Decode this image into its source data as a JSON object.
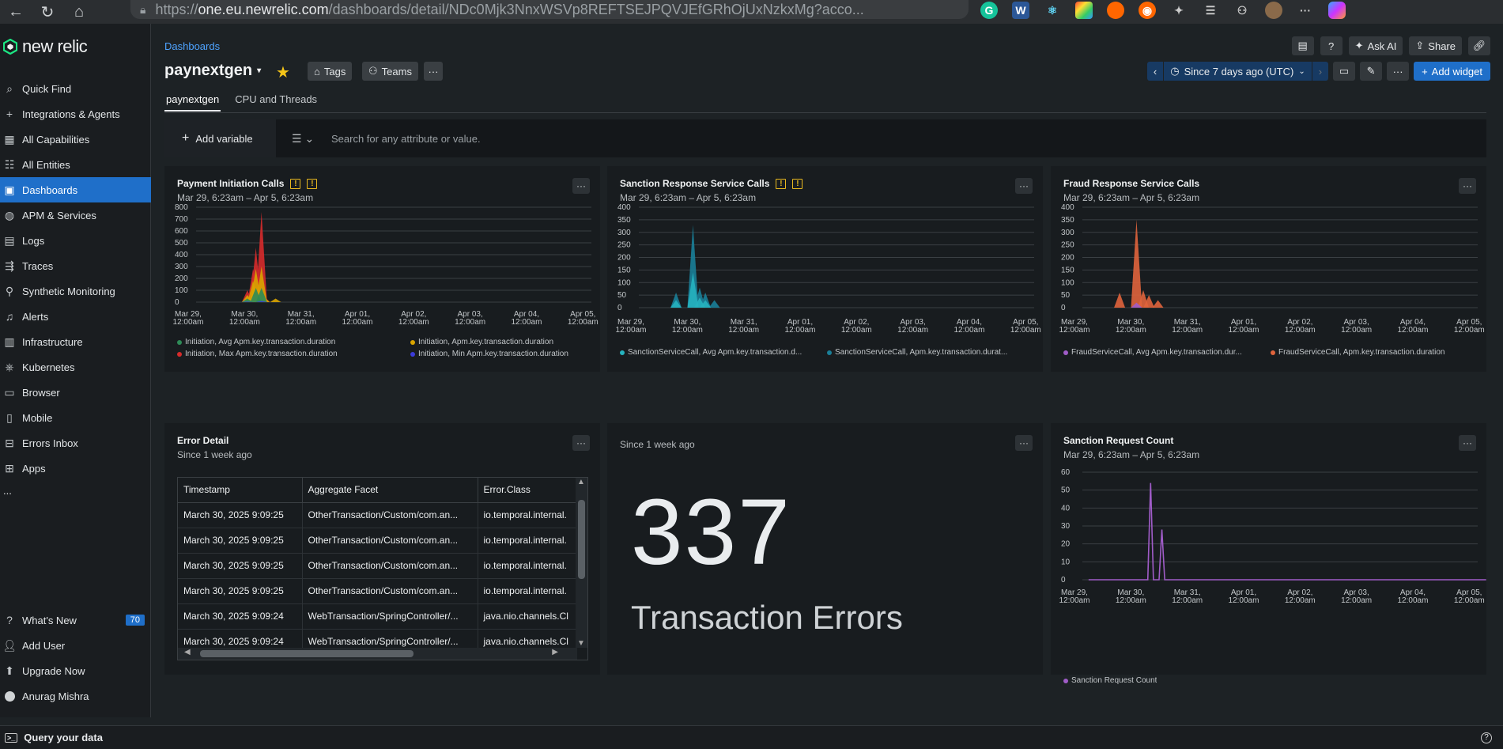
{
  "browser": {
    "url_prefix": "https://",
    "url_domain": "one.eu.newrelic.com",
    "url_path": "/dashboards/detail/NDc0Mjk3NnxWSVp8REFTSEJPQVJEfGRhOjUxNzkxMg?acco..."
  },
  "app": {
    "logo_text": "new relic"
  },
  "sidebar": {
    "items": [
      {
        "label": "Quick Find",
        "icon": "search-icon"
      },
      {
        "label": "Integrations & Agents",
        "icon": "plus-icon"
      },
      {
        "label": "All Capabilities",
        "icon": "grid-icon"
      },
      {
        "label": "All Entities",
        "icon": "list-icon"
      },
      {
        "label": "Dashboards",
        "icon": "dashboard-icon",
        "active": true
      },
      {
        "label": "APM & Services",
        "icon": "globe-icon"
      },
      {
        "label": "Logs",
        "icon": "doc-icon"
      },
      {
        "label": "Traces",
        "icon": "trace-icon"
      },
      {
        "label": "Synthetic Monitoring",
        "icon": "monitor-icon"
      },
      {
        "label": "Alerts",
        "icon": "bell-icon"
      },
      {
        "label": "Infrastructure",
        "icon": "server-icon"
      },
      {
        "label": "Kubernetes",
        "icon": "kubernetes-icon"
      },
      {
        "label": "Browser",
        "icon": "browser-icon"
      },
      {
        "label": "Mobile",
        "icon": "mobile-icon"
      },
      {
        "label": "Errors Inbox",
        "icon": "inbox-icon"
      },
      {
        "label": "Apps",
        "icon": "apps-icon"
      }
    ],
    "more": "...",
    "bottom": [
      {
        "label": "What's New",
        "badge": "70"
      },
      {
        "label": "Add User"
      },
      {
        "label": "Upgrade Now"
      },
      {
        "label": "Anurag Mishra"
      }
    ]
  },
  "query_bar": {
    "label": "Query your data"
  },
  "header": {
    "breadcrumb": "Dashboards",
    "title": "paynextgen",
    "tags_label": "Tags",
    "teams_label": "Teams",
    "more": "···",
    "ask_ai": "Ask AI",
    "share": "Share",
    "time_range": "Since 7 days ago (UTC)",
    "add_widget": "Add widget"
  },
  "tabs": [
    {
      "label": "paynextgen",
      "active": true
    },
    {
      "label": "CPU and Threads",
      "active": false
    }
  ],
  "variables": {
    "add_variable": "Add variable",
    "search_placeholder": "Search for any attribute or value."
  },
  "x_ticks": [
    "Mar 29,",
    "Mar 30,",
    "Mar 31,",
    "Apr 01,",
    "Apr 02,",
    "Apr 03,",
    "Apr 04,",
    "Apr 05,"
  ],
  "x_tick_time": "12:00am",
  "widgets": {
    "payment": {
      "title": "Payment Initiation Calls",
      "subtitle": "Mar 29, 6:23am – Apr 5, 6:23am",
      "legend": [
        {
          "label": "Initiation, Avg Apm.key.transaction.duration",
          "color": "#2e8b57"
        },
        {
          "label": "Initiation, Apm.key.transaction.duration",
          "color": "#d9a400"
        },
        {
          "label": "Initiation, Max Apm.key.transaction.duration",
          "color": "#d62b2b"
        },
        {
          "label": "Initiation, Min Apm.key.transaction.duration",
          "color": "#3b3bd9"
        }
      ]
    },
    "sanction": {
      "title": "Sanction Response Service Calls",
      "subtitle": "Mar 29, 6:23am – Apr 5, 6:23am",
      "legend": [
        {
          "label": "SanctionServiceCall, Avg Apm.key.transaction.d...",
          "color": "#26b3bf"
        },
        {
          "label": "SanctionServiceCall, Apm.key.transaction.durat...",
          "color": "#1a7f98"
        }
      ]
    },
    "fraud": {
      "title": "Fraud Response Service Calls",
      "subtitle": "Mar 29, 6:23am – Apr 5, 6:23am",
      "legend": [
        {
          "label": "FraudServiceCall, Avg Apm.key.transaction.dur...",
          "color": "#a05cc8"
        },
        {
          "label": "FraudServiceCall, Apm.key.transaction.duration",
          "color": "#e0643c"
        }
      ]
    },
    "error_detail": {
      "title": "Error Detail",
      "subtitle": "Since 1 week ago",
      "columns": [
        "Timestamp",
        "Aggregate Facet",
        "Error.Class"
      ],
      "rows": [
        [
          "March 30, 2025 9:09:25",
          "OtherTransaction/Custom/com.an...",
          "io.temporal.internal."
        ],
        [
          "March 30, 2025 9:09:25",
          "OtherTransaction/Custom/com.an...",
          "io.temporal.internal."
        ],
        [
          "March 30, 2025 9:09:25",
          "OtherTransaction/Custom/com.an...",
          "io.temporal.internal."
        ],
        [
          "March 30, 2025 9:09:25",
          "OtherTransaction/Custom/com.an...",
          "io.temporal.internal."
        ],
        [
          "March 30, 2025 9:09:24",
          "WebTransaction/SpringController/...",
          "java.nio.channels.Cl"
        ],
        [
          "March 30, 2025 9:09:24",
          "WebTransaction/SpringController/...",
          "java.nio.channels.Cl"
        ]
      ]
    },
    "billboard": {
      "subtitle": "Since 1 week ago",
      "value": "337",
      "label": "Transaction Errors"
    },
    "sanction_count": {
      "title": "Sanction Request Count",
      "subtitle": "Mar 29, 6:23am – Apr 5, 6:23am",
      "legend": [
        {
          "label": "Sanction Request Count",
          "color": "#a05cc8"
        }
      ]
    }
  },
  "chart_data": [
    {
      "type": "area",
      "title": "Payment Initiation Calls",
      "x": [
        "Mar 29, 12:00am",
        "Mar 30, 12:00am",
        "Mar 31, 12:00am",
        "Apr 01, 12:00am",
        "Apr 02, 12:00am",
        "Apr 03, 12:00am",
        "Apr 04, 12:00am",
        "Apr 05, 12:00am"
      ],
      "ylim": [
        0,
        800
      ],
      "yticks": [
        0,
        100,
        200,
        300,
        400,
        500,
        600,
        700,
        800
      ],
      "series": [
        {
          "name": "Initiation, Max Apm.key.transaction.duration",
          "color": "#d62b2b",
          "points": [
            [
              1.05,
              100
            ],
            [
              1.15,
              280
            ],
            [
              1.2,
              460
            ],
            [
              1.3,
              760
            ],
            [
              1.35,
              50
            ]
          ]
        },
        {
          "name": "Initiation, Apm.key.transaction.duration",
          "color": "#d9a400",
          "points": [
            [
              1.05,
              60
            ],
            [
              1.15,
              180
            ],
            [
              1.2,
              280
            ],
            [
              1.3,
              300
            ],
            [
              1.35,
              40
            ],
            [
              1.55,
              30
            ]
          ]
        },
        {
          "name": "Initiation, Avg Apm.key.transaction.duration",
          "color": "#2e8b57",
          "points": [
            [
              1.05,
              30
            ],
            [
              1.2,
              120
            ],
            [
              1.3,
              120
            ]
          ]
        },
        {
          "name": "Initiation, Min Apm.key.transaction.duration",
          "color": "#3b3bd9",
          "points": [
            [
              1.05,
              5
            ],
            [
              1.3,
              10
            ]
          ]
        }
      ]
    },
    {
      "type": "area",
      "title": "Sanction Response Service Calls",
      "x": [
        "Mar 29, 12:00am",
        "Mar 30, 12:00am",
        "Mar 31, 12:00am",
        "Apr 01, 12:00am",
        "Apr 02, 12:00am",
        "Apr 03, 12:00am",
        "Apr 04, 12:00am",
        "Apr 05, 12:00am"
      ],
      "ylim": [
        0,
        400
      ],
      "yticks": [
        0,
        50,
        100,
        150,
        200,
        250,
        300,
        350,
        400
      ],
      "series": [
        {
          "name": "SanctionServiceCall, Apm.key.transaction.durat...",
          "color": "#1a7f98",
          "points": [
            [
              0.8,
              60
            ],
            [
              1.1,
              330
            ],
            [
              1.22,
              80
            ],
            [
              1.32,
              60
            ],
            [
              1.48,
              30
            ]
          ]
        },
        {
          "name": "SanctionServiceCall, Avg Apm.key.transaction.d...",
          "color": "#26b3bf",
          "points": [
            [
              0.8,
              30
            ],
            [
              1.1,
              140
            ],
            [
              1.22,
              40
            ],
            [
              1.32,
              30
            ]
          ]
        }
      ]
    },
    {
      "type": "area",
      "title": "Fraud Response Service Calls",
      "x": [
        "Mar 29, 12:00am",
        "Mar 30, 12:00am",
        "Mar 31, 12:00am",
        "Apr 01, 12:00am",
        "Apr 02, 12:00am",
        "Apr 03, 12:00am",
        "Apr 04, 12:00am",
        "Apr 05, 12:00am"
      ],
      "ylim": [
        0,
        400
      ],
      "yticks": [
        0,
        50,
        100,
        150,
        200,
        250,
        300,
        350,
        400
      ],
      "series": [
        {
          "name": "FraudServiceCall, Apm.key.transaction.duration",
          "color": "#e0643c",
          "points": [
            [
              0.8,
              60
            ],
            [
              1.1,
              350
            ],
            [
              1.22,
              70
            ],
            [
              1.32,
              50
            ],
            [
              1.48,
              30
            ]
          ]
        },
        {
          "name": "FraudServiceCall, Avg Apm.key.transaction.dur...",
          "color": "#a05cc8",
          "points": [
            [
              1.1,
              20
            ]
          ]
        }
      ]
    },
    {
      "type": "line",
      "title": "Sanction Request Count",
      "x": [
        "Mar 29, 12:00am",
        "Mar 30, 12:00am",
        "Mar 31, 12:00am",
        "Apr 01, 12:00am",
        "Apr 02, 12:00am",
        "Apr 03, 12:00am",
        "Apr 04, 12:00am",
        "Apr 05, 12:00am"
      ],
      "ylim": [
        0,
        60
      ],
      "yticks": [
        0,
        10,
        20,
        30,
        40,
        50,
        60
      ],
      "series": [
        {
          "name": "Sanction Request Count",
          "color": "#a05cc8",
          "points": [
            [
              0.25,
              0
            ],
            [
              1.3,
              0
            ],
            [
              1.35,
              54
            ],
            [
              1.4,
              0
            ],
            [
              1.5,
              0
            ],
            [
              1.55,
              28
            ],
            [
              1.6,
              0
            ],
            [
              7.3,
              0
            ]
          ]
        }
      ]
    }
  ]
}
